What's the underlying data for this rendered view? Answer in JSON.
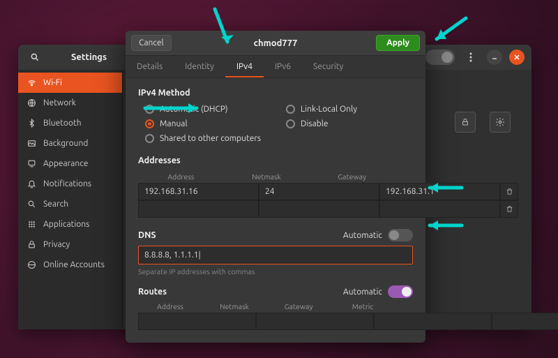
{
  "settings": {
    "title": "Settings",
    "sidebar": [
      {
        "icon": "wifi",
        "label": "Wi-Fi",
        "active": true
      },
      {
        "icon": "globe",
        "label": "Network",
        "active": false
      },
      {
        "icon": "bluetooth",
        "label": "Bluetooth",
        "active": false
      },
      {
        "icon": "background",
        "label": "Background",
        "active": false
      },
      {
        "icon": "appearance",
        "label": "Appearance",
        "active": false
      },
      {
        "icon": "bell",
        "label": "Notifications",
        "active": false
      },
      {
        "icon": "search",
        "label": "Search",
        "active": false
      },
      {
        "icon": "grid",
        "label": "Applications",
        "active": false
      },
      {
        "icon": "lock",
        "label": "Privacy",
        "active": false
      },
      {
        "icon": "online",
        "label": "Online Accounts",
        "active": false
      }
    ]
  },
  "dialog": {
    "cancel": "Cancel",
    "apply": "Apply",
    "title": "chmod777",
    "tabs": [
      {
        "label": "Details",
        "active": false
      },
      {
        "label": "Identity",
        "active": false
      },
      {
        "label": "IPv4",
        "active": true
      },
      {
        "label": "IPv6",
        "active": false
      },
      {
        "label": "Security",
        "active": false
      }
    ],
    "ipv4": {
      "method_title": "IPv4 Method",
      "methods": {
        "auto": "Automatic (DHCP)",
        "link": "Link-Local Only",
        "manual": "Manual",
        "disable": "Disable",
        "shared": "Shared to other computers"
      },
      "selected_method": "manual",
      "addresses_title": "Addresses",
      "addr_headers": {
        "address": "Address",
        "netmask": "Netmask",
        "gateway": "Gateway"
      },
      "addr_rows": [
        {
          "address": "192.168.31.16",
          "netmask": "24",
          "gateway": "192.168.31.1"
        },
        {
          "address": "",
          "netmask": "",
          "gateway": ""
        }
      ],
      "dns_title": "DNS",
      "automatic_label": "Automatic",
      "dns_auto_on": false,
      "dns_value": "8.8.8.8, 1.1.1.1|",
      "dns_hint": "Separate IP addresses with commas",
      "routes_title": "Routes",
      "routes_auto_on": true,
      "routes_headers": {
        "address": "Address",
        "netmask": "Netmask",
        "gateway": "Gateway",
        "metric": "Metric"
      }
    }
  }
}
